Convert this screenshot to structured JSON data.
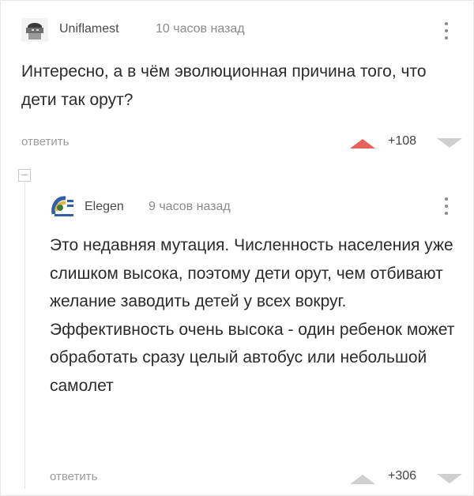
{
  "comments": [
    {
      "author": "Uniflamest",
      "time": "10 часов назад",
      "text": "Интересно, а в чём эволюционная причина того, что дети так орут?",
      "reply_label": "ответить",
      "rating": "+108",
      "voted": "up"
    },
    {
      "author": "Elegen",
      "time": "9 часов назад",
      "text": "Это недавняя мутация. Численность населения уже слишком высока, поэтому дети орут, чем отбивают желание заводить детей у всех вокруг. Эффективность очень высока - один ребенок может обработать сразу целый автобус или небольшой самолет",
      "reply_label": "ответить",
      "rating": "+306",
      "voted": "none"
    }
  ],
  "colors": {
    "upvote_active": "#e5635c",
    "vote_inactive": "#cfcfcf",
    "reply_link": "#9a9a9a",
    "muted_text": "#8a8a8a"
  },
  "icons": {
    "avatar1": "user-avatar-icon",
    "avatar2": "user-avatar-icon",
    "more": "vertical-dots-icon",
    "upvote": "triangle-up-icon",
    "downvote": "triangle-down-icon",
    "collapse": "minus-square-icon"
  }
}
